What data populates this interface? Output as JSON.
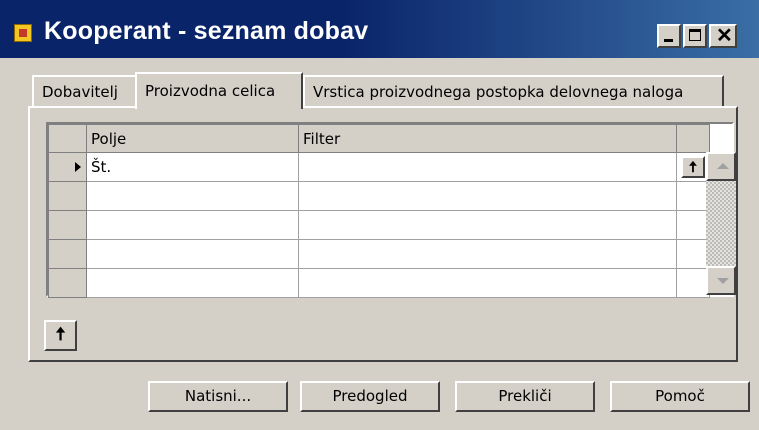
{
  "window": {
    "title": "Kooperant - seznam dobav",
    "close_glyph": "✕"
  },
  "tabs": [
    {
      "label": "Dobavitelj"
    },
    {
      "label": "Proizvodna celica",
      "active": true
    },
    {
      "label": "Vrstica proizvodnega postopka delovnega naloga"
    }
  ],
  "grid": {
    "headers": {
      "field": "Polje",
      "filter": "Filter"
    },
    "rows": [
      {
        "field": "Št.",
        "filter": ""
      },
      {
        "field": "",
        "filter": ""
      },
      {
        "field": "",
        "filter": ""
      },
      {
        "field": "",
        "filter": ""
      },
      {
        "field": "",
        "filter": ""
      }
    ],
    "row_up_glyph": "🠅"
  },
  "up_button_glyph": "🠅",
  "buttons": {
    "print": "Natisni...",
    "preview": "Predogled",
    "cancel": "Prekliči",
    "help": "Pomoč"
  },
  "colors": {
    "titlebar": "#0a246a",
    "face": "#d4d0c8"
  }
}
